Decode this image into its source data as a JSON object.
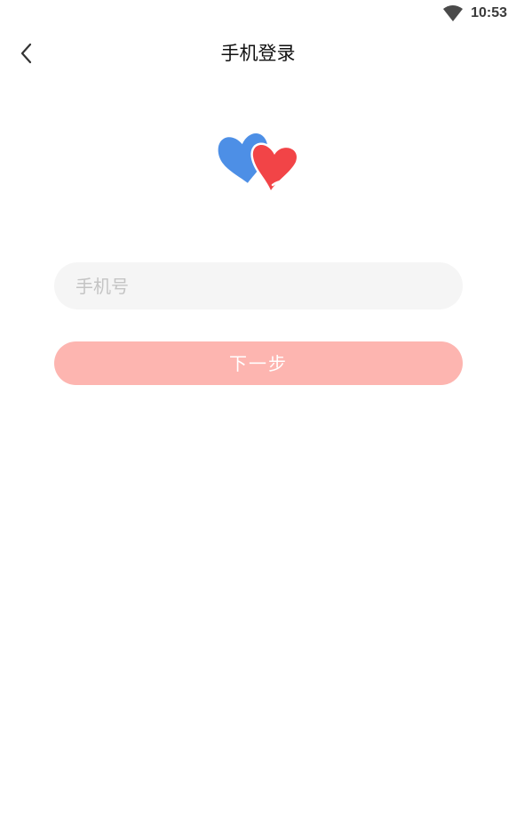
{
  "status_bar": {
    "time": "10:53",
    "wifi_icon": "wifi-icon"
  },
  "header": {
    "back_icon": "chevron-left-icon",
    "title": "手机登录"
  },
  "logo": {
    "icon": "twin-hearts-logo",
    "colors": {
      "blue": "#4d8fe6",
      "red": "#f24447"
    }
  },
  "form": {
    "phone_placeholder": "手机号",
    "phone_value": "",
    "next_label": "下一步"
  },
  "colors": {
    "primary_disabled": "#fdb5b0",
    "input_bg": "#f5f5f5",
    "placeholder": "#c4c4c4"
  }
}
